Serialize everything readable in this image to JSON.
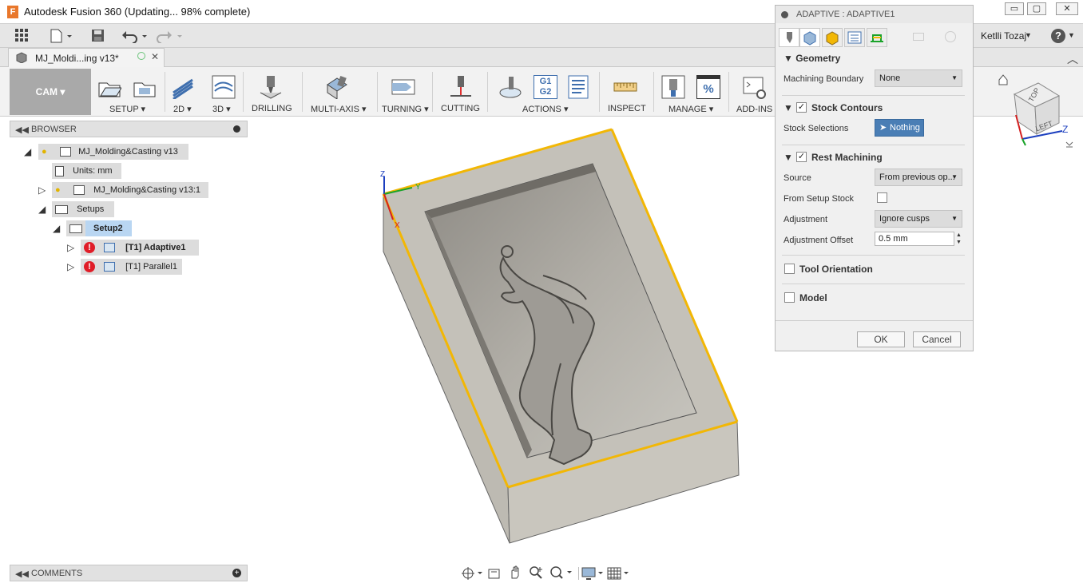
{
  "window": {
    "app_title": "Autodesk Fusion 360  (Updating... 98% complete)",
    "logo_letter": "F",
    "min_glyph": "▭",
    "max_glyph": "▢",
    "close_glyph": "✕"
  },
  "quick_access": {
    "grid_icon": "apps-grid-icon",
    "user_name": "Ketlli Tozaj",
    "user_caret": "▼",
    "help_glyph": "?",
    "help_caret": "▼"
  },
  "document_tab": {
    "label": "MJ_Moldi...ing v13*",
    "close_glyph": "✕"
  },
  "ribbon": {
    "workspace": "CAM",
    "groups": [
      {
        "label": "SETUP ▾"
      },
      {
        "label": "2D ▾"
      },
      {
        "label": "3D ▾"
      },
      {
        "label": "DRILLING"
      },
      {
        "label": "MULTI-AXIS ▾"
      },
      {
        "label": "TURNING ▾"
      },
      {
        "label": "CUTTING"
      },
      {
        "label": "ACTIONS ▾"
      },
      {
        "label": "INSPECT"
      },
      {
        "label": "MANAGE ▾"
      },
      {
        "label": "ADD-INS ▾"
      }
    ],
    "g1g2_icon_text": "G1\nG2",
    "percent_icon_text": "%"
  },
  "browser": {
    "header": "BROWSER",
    "comments_header": "COMMENTS",
    "tree": [
      {
        "label": "MJ_Molding&Casting v13"
      },
      {
        "label": "Units: mm"
      },
      {
        "label": "MJ_Molding&Casting v13:1"
      },
      {
        "label": "Setups"
      },
      {
        "label": "Setup2"
      },
      {
        "label": "[T1] Adaptive1"
      },
      {
        "label": "[T1] Parallel1"
      }
    ],
    "error_glyph": "!"
  },
  "viewport": {
    "axis_z": "Z",
    "axis_y": "Y",
    "axis_x": "X",
    "viewcube_top": "TOP",
    "viewcube_left": "LEFT",
    "viewcube_z": "Z",
    "viewcube_x": "X"
  },
  "panel": {
    "title": "ADAPTIVE : ADAPTIVE1",
    "geometry": {
      "header": "Geometry",
      "machining_boundary_label": "Machining Boundary",
      "machining_boundary_value": "None"
    },
    "stock_contours": {
      "header": "Stock Contours",
      "checked": true,
      "stock_selections_label": "Stock Selections",
      "stock_selections_value": "Nothing"
    },
    "rest_machining": {
      "header": "Rest Machining",
      "checked": true,
      "source_label": "Source",
      "source_value": "From previous op...",
      "from_setup_stock_label": "From Setup Stock",
      "from_setup_stock_checked": false,
      "adjustment_label": "Adjustment",
      "adjustment_value": "Ignore cusps",
      "adjustment_offset_label": "Adjustment Offset",
      "adjustment_offset_value": "0.5 mm"
    },
    "tool_orientation": {
      "header": "Tool Orientation",
      "checked": false
    },
    "model": {
      "header": "Model",
      "checked": false
    },
    "ok_label": "OK",
    "cancel_label": "Cancel",
    "check_glyph": "✓"
  },
  "colors": {
    "accent_blue": "#4a7eb5",
    "error_red": "#e01d28",
    "edge_yellow": "#f2b705",
    "model_gray": "#c4c1b9"
  }
}
